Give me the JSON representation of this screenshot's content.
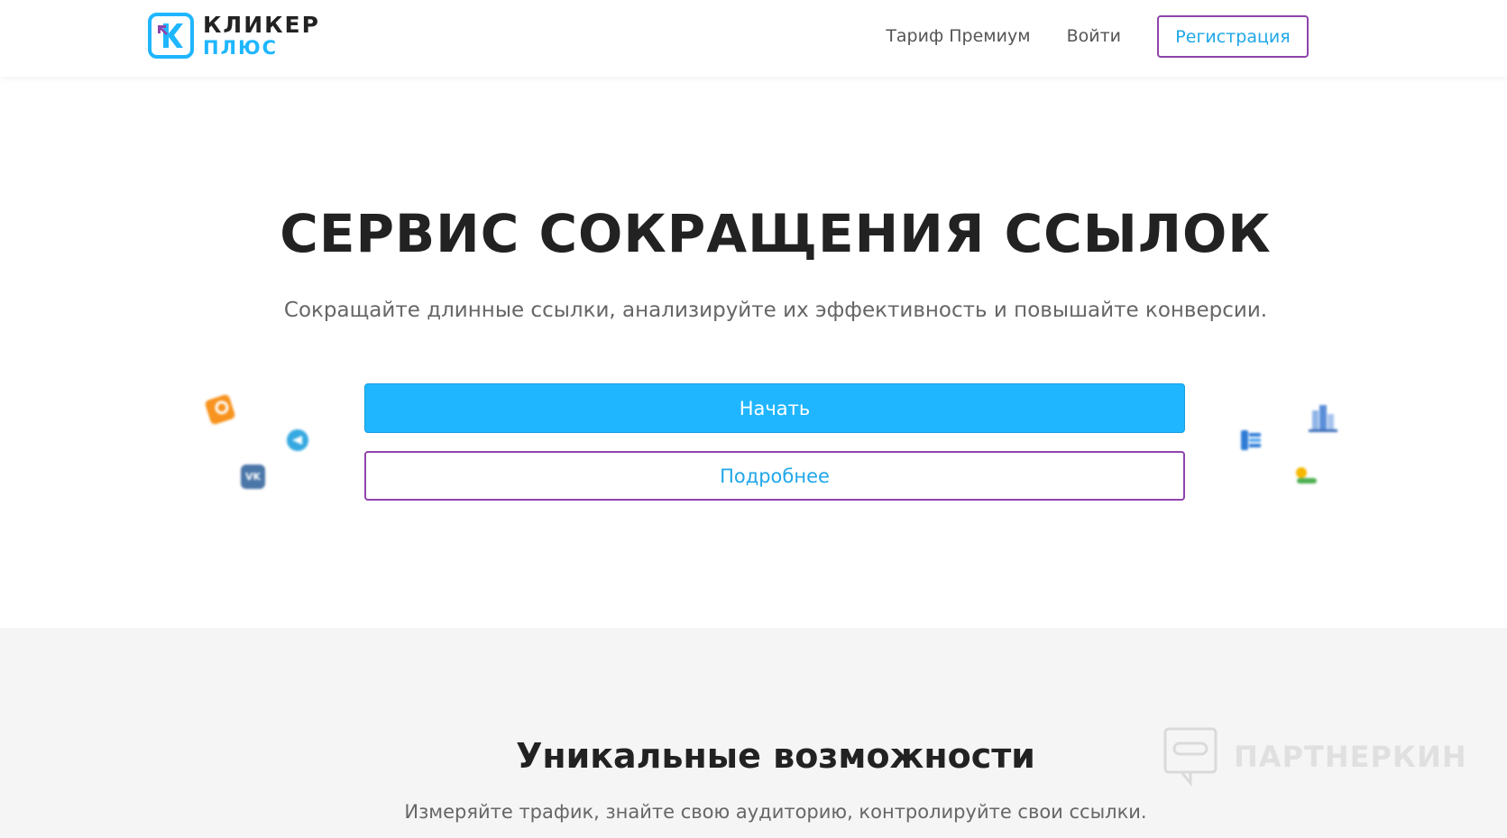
{
  "header": {
    "logo_line1": "КЛИКЕР",
    "logo_line2": "ПЛЮС",
    "nav": {
      "premium_label": "Тариф Премиум",
      "login_label": "Войти",
      "register_label": "Регистрация"
    }
  },
  "hero": {
    "title": "СЕРВИС СОКРАЩЕНИЯ ССЫЛОК",
    "subtitle": "Сокращайте длинные ссылки, анализируйте их эффективность и повышайте конверсии.",
    "start_label": "Начать",
    "more_label": "Подробнее",
    "floating_icons": {
      "vk_text": "VK",
      "icons": [
        "odnoklassniki-icon",
        "telegram-icon",
        "vk-icon",
        "hand-money-icon",
        "city-icon",
        "coin-icon"
      ]
    }
  },
  "features": {
    "title": "Уникальные возможности",
    "subtitle": "Измеряйте трафик, знайте свою аудиторию, контролируйте свои ссылки."
  },
  "watermark": {
    "text": "ПАРТНЕРКИН"
  },
  "colors": {
    "accent_blue": "#1fb6ff",
    "accent_purple": "#8e44ad",
    "link_blue": "#1fa7e8",
    "section_bg": "#f5f5f5"
  }
}
